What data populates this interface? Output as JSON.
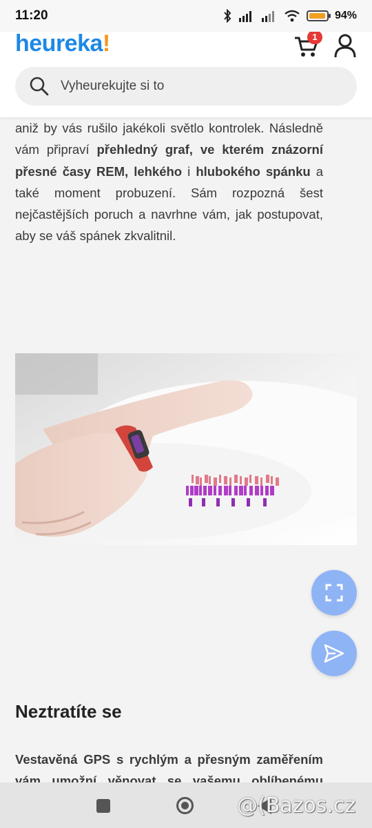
{
  "status_bar": {
    "time": "11:20",
    "battery_percent": "94%",
    "battery_level": 0.94,
    "icons": [
      "bluetooth-icon",
      "signal-icon",
      "signal-icon",
      "wifi-icon",
      "battery-icon"
    ]
  },
  "header": {
    "logo_text": "heureka",
    "logo_accent": "!",
    "cart_count": "1",
    "search_placeholder": "Vyheurekujte si to"
  },
  "article": {
    "p1": {
      "t1": "aniž by vás rušilo jakékoli světlo kontrolek. Následně vám připraví ",
      "b1": "přehledný graf, ve kterém znázorní přesné časy REM, lehkého",
      "t2": " i ",
      "b2": "hlubokého spánku",
      "t3": " a také moment probuzení. Sám rozpozná šest nejčastějších poruch a navrhne vám, jak postupovat, aby se váš spánek zkvalitnil."
    },
    "heading": "Neztratíte se",
    "p2": "Vestavěná GPS s rychlým a přesným zaměřením vám umožní věnovat se vašemu oblíbenému sportu"
  },
  "watermark": "@(Bazos.cz",
  "colors": {
    "brand_blue": "#1e88e5",
    "brand_orange": "#f7941d",
    "fab_blue": "#8fb4f5",
    "badge_red": "#e53935"
  }
}
